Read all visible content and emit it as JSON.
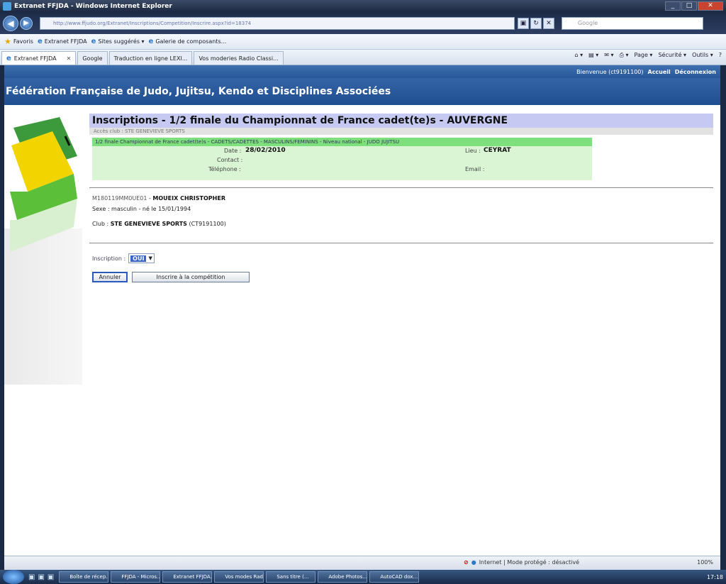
{
  "window": {
    "title": "Extranet FFJDA - Windows Internet Explorer"
  },
  "addressbar": {
    "url": "http://www.ffjudo.org/Extranet/Inscriptions/Competition/Inscrire.aspx?id=18374",
    "search_placeholder": "Google"
  },
  "favorites": {
    "label": "Favoris",
    "items": [
      "Extranet FFJDA",
      "Sites suggérés ▾",
      "Galerie de composants..."
    ]
  },
  "tabs": [
    {
      "label": "Extranet FFJDA",
      "active": true
    },
    {
      "label": "Google",
      "active": false
    },
    {
      "label": "Traduction en ligne LEXI...",
      "active": false
    },
    {
      "label": "Vos moderies Radio Classi...",
      "active": false
    }
  ],
  "commandbar": {
    "page": "Page ▾",
    "security": "Sécurité ▾",
    "tools": "Outils ▾"
  },
  "site": {
    "welcome": "Bienvenue (ct9191100)",
    "home": "Accueil",
    "logout": "Déconnexion",
    "banner": "Fédération Française de Judo, Jujitsu, Kendo et Disciplines Associées"
  },
  "main": {
    "title": "Inscriptions - 1/2 finale du Championnat de France cadet(te)s - AUVERGNE",
    "subtitle": "Accès club : STE GENEVIEVE SPORTS",
    "competition": {
      "header": "1/2 finale Championnat de France cadet(te)s - CADETS/CADETTES - MASCULINS/FEMININS - Niveau national - JUDO JUJITSU",
      "date_label": "Date :",
      "date_value": "28/02/2010",
      "lieu_label": "Lieu :",
      "lieu_value": "CEYRAT",
      "contact_label": "Contact :",
      "telephone_label": "Téléphone :",
      "email_label": "Email :"
    },
    "person": {
      "id": "M180119MM0UE01",
      "name": "MOUEIX CHRISTOPHER",
      "sexe_line": "Sexe : masculin - né le 15/01/1994",
      "club_label": "Club :",
      "club_name": "STE GENEVIEVE SPORTS",
      "club_code": "(CT9191100)"
    },
    "inscription": {
      "label": "Inscription :",
      "value": "OUI"
    },
    "buttons": {
      "cancel": "Annuler",
      "register": "Inscrire à la compétition"
    }
  },
  "statusbar": {
    "zone": "Internet | Mode protégé : désactivé",
    "zoom": "100%"
  },
  "taskbar": {
    "tasks": [
      "Boîte de récep...",
      "FFJDA - Micros...",
      "Extranet FFJDA...",
      "Vos modes Radio...",
      "Sans titre (...",
      "Adobe Photos...",
      "AutoCAD dox..."
    ],
    "clock": "17:18"
  }
}
